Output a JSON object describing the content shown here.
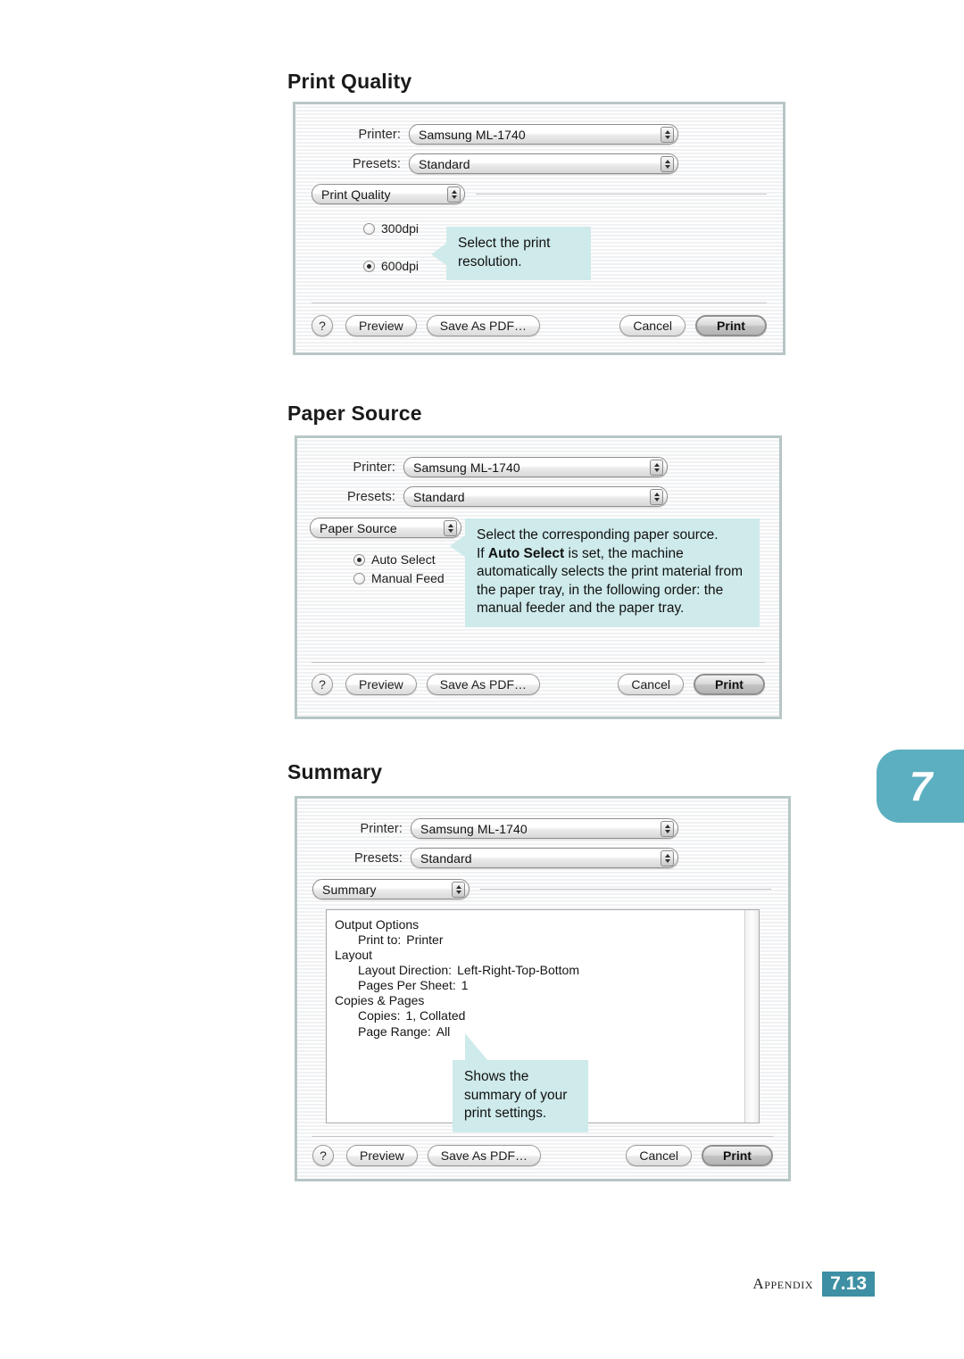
{
  "page": {
    "chapter_tab": "7",
    "footer_label": "Appendix",
    "footer_page": "7.13",
    "teal": "#5cafc0",
    "footer_box_color": "#3d8fa3",
    "callout_color": "#cfeaeb"
  },
  "sections": [
    {
      "id": "print-quality",
      "heading": "Print Quality"
    },
    {
      "id": "paper-source",
      "heading": "Paper Source"
    },
    {
      "id": "summary",
      "heading": "Summary"
    }
  ],
  "common": {
    "printer_label": "Printer:",
    "presets_label": "Presets:",
    "printer_value": "Samsung ML-1740",
    "presets_value": "Standard",
    "help_icon": "?",
    "buttons": {
      "preview": "Preview",
      "save_as_pdf": "Save As PDF…",
      "cancel": "Cancel",
      "print": "Print"
    }
  },
  "dialog1": {
    "pane": "Print Quality",
    "options": [
      {
        "label": "300dpi",
        "selected": false
      },
      {
        "label": "600dpi",
        "selected": true
      }
    ],
    "callout": "Select the print resolution."
  },
  "dialog2": {
    "pane": "Paper Source",
    "options": [
      {
        "label": "Auto Select",
        "selected": true
      },
      {
        "label": "Manual Feed",
        "selected": false
      }
    ],
    "callout_line1": "Select the corresponding paper source.",
    "callout_line2_a": "If ",
    "callout_line2_bold": "Auto Select",
    "callout_line2_b": " is set, the machine automatically selects the print material from the paper tray, in the following order: the manual feeder and the paper tray."
  },
  "dialog3": {
    "pane": "Summary",
    "summary": [
      {
        "type": "group",
        "text": "Output Options"
      },
      {
        "type": "item",
        "key": "Print to:",
        "value": "Printer"
      },
      {
        "type": "group",
        "text": "Layout"
      },
      {
        "type": "item",
        "key": "Layout Direction:",
        "value": "Left-Right-Top-Bottom"
      },
      {
        "type": "item",
        "key": "Pages Per Sheet:",
        "value": "1"
      },
      {
        "type": "group",
        "text": "Copies & Pages"
      },
      {
        "type": "item",
        "key": "Copies:",
        "value": "1, Collated"
      },
      {
        "type": "item",
        "key": "Page Range:",
        "value": "All"
      }
    ],
    "callout": "Shows the summary of your print settings."
  }
}
